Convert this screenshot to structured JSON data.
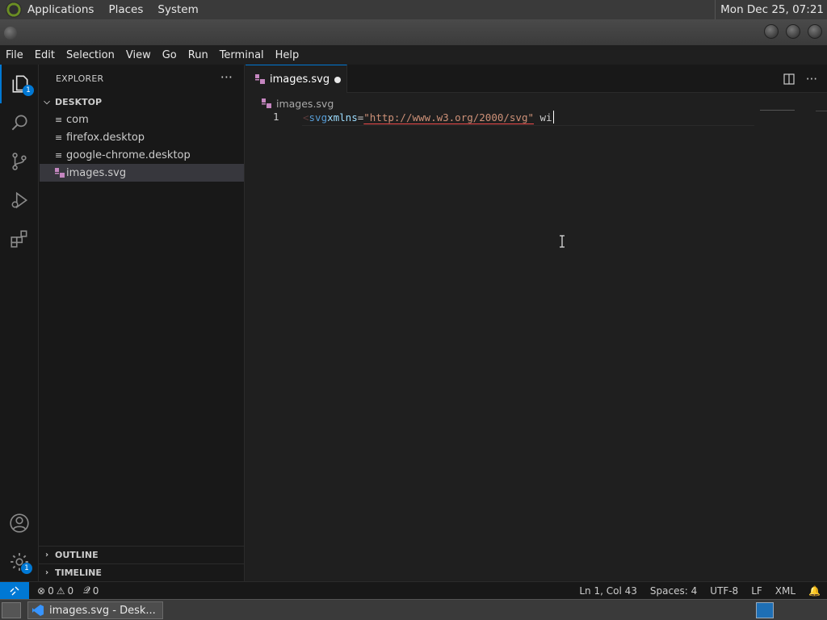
{
  "top_panel": {
    "menus": [
      "Applications",
      "Places",
      "System"
    ],
    "clock": "Mon Dec 25, 07:21"
  },
  "menubar": [
    "File",
    "Edit",
    "Selection",
    "View",
    "Go",
    "Run",
    "Terminal",
    "Help"
  ],
  "activity_bar": {
    "explorer_badge": "1",
    "settings_badge": "1",
    "icons": [
      "files-icon",
      "search-icon",
      "source-control-icon",
      "run-debug-icon",
      "extensions-icon",
      "account-icon",
      "settings-gear-icon"
    ]
  },
  "sidebar": {
    "title": "EXPLORER",
    "more": "···",
    "folder": "DESKTOP",
    "files": [
      {
        "name": "com",
        "icon": "file-lines-icon"
      },
      {
        "name": "firefox.desktop",
        "icon": "file-lines-icon"
      },
      {
        "name": "google-chrome.desktop",
        "icon": "file-lines-icon"
      },
      {
        "name": "images.svg",
        "icon": "svg-file-icon",
        "selected": true
      }
    ],
    "outline": "OUTLINE",
    "timeline": "TIMELINE"
  },
  "editor": {
    "tab_label": "images.svg",
    "breadcrumb": "images.svg",
    "line_number": "1",
    "code": {
      "bracket": "<",
      "tag": "svg",
      "attr": "xmlns",
      "eq": "=",
      "value": "\"http://www.w3.org/2000/svg\"",
      "rest": " wi"
    }
  },
  "statusbar": {
    "errors": "0",
    "warnings": "0",
    "ports": "0",
    "position": "Ln 1, Col 43",
    "spaces": "Spaces: 4",
    "encoding": "UTF-8",
    "eol": "LF",
    "language": "XML"
  },
  "taskbar": {
    "window_label": "images.svg - Desk..."
  },
  "colors": {
    "accent": "#0078d4",
    "editor_bg": "#1f1f1f",
    "sidebar_bg": "#181818"
  }
}
